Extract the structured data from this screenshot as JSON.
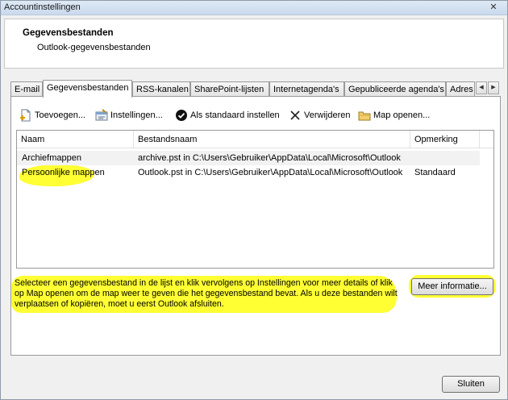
{
  "window": {
    "title": "Accountinstellingen",
    "close_glyph": "✕"
  },
  "header": {
    "title": "Gegevensbestanden",
    "subtitle": "Outlook-gegevensbestanden"
  },
  "tabs": [
    {
      "label": "E-mail"
    },
    {
      "label": "Gegevensbestanden",
      "active": true
    },
    {
      "label": "RSS-kanalen"
    },
    {
      "label": "SharePoint-lijsten"
    },
    {
      "label": "Internetagenda's"
    },
    {
      "label": "Gepubliceerde agenda's"
    },
    {
      "label": "Adres"
    }
  ],
  "tab_scroll": {
    "left": "◀",
    "right": "▶"
  },
  "toolbar": {
    "add": {
      "label": "Toevoegen...",
      "icon": "add-file-icon"
    },
    "settings": {
      "label": "Instellingen...",
      "icon": "settings-icon"
    },
    "default": {
      "label": "Als standaard instellen",
      "icon": "checkmark-circle-icon"
    },
    "remove": {
      "label": "Verwijderen",
      "icon": "x-icon"
    },
    "open": {
      "label": "Map openen...",
      "icon": "folder-icon"
    }
  },
  "list": {
    "columns": [
      "Naam",
      "Bestandsnaam",
      "Opmerking"
    ],
    "rows": [
      {
        "name": "Archiefmappen",
        "file": "archive.pst in C:\\Users\\Gebruiker\\AppData\\Local\\Microsoft\\Outlook",
        "note": ""
      },
      {
        "name": "Persoonlijke mappen",
        "file": "Outlook.pst in C:\\Users\\Gebruiker\\AppData\\Local\\Microsoft\\Outlook",
        "note": "Standaard"
      }
    ]
  },
  "info": {
    "text": "Selecteer een gegevensbestand in de lijst en klik vervolgens op Instellingen voor meer details of klik op Map openen om de map weer te geven die het gegevensbestand bevat. Als u deze bestanden wilt verplaatsen of kopiëren, moet u eerst Outlook afsluiten.",
    "more_button": "Meer informatie..."
  },
  "footer": {
    "close_button": "Sluiten"
  },
  "colors": {
    "highlight": "#ffff33",
    "selected_row": "#f2f2f2"
  }
}
